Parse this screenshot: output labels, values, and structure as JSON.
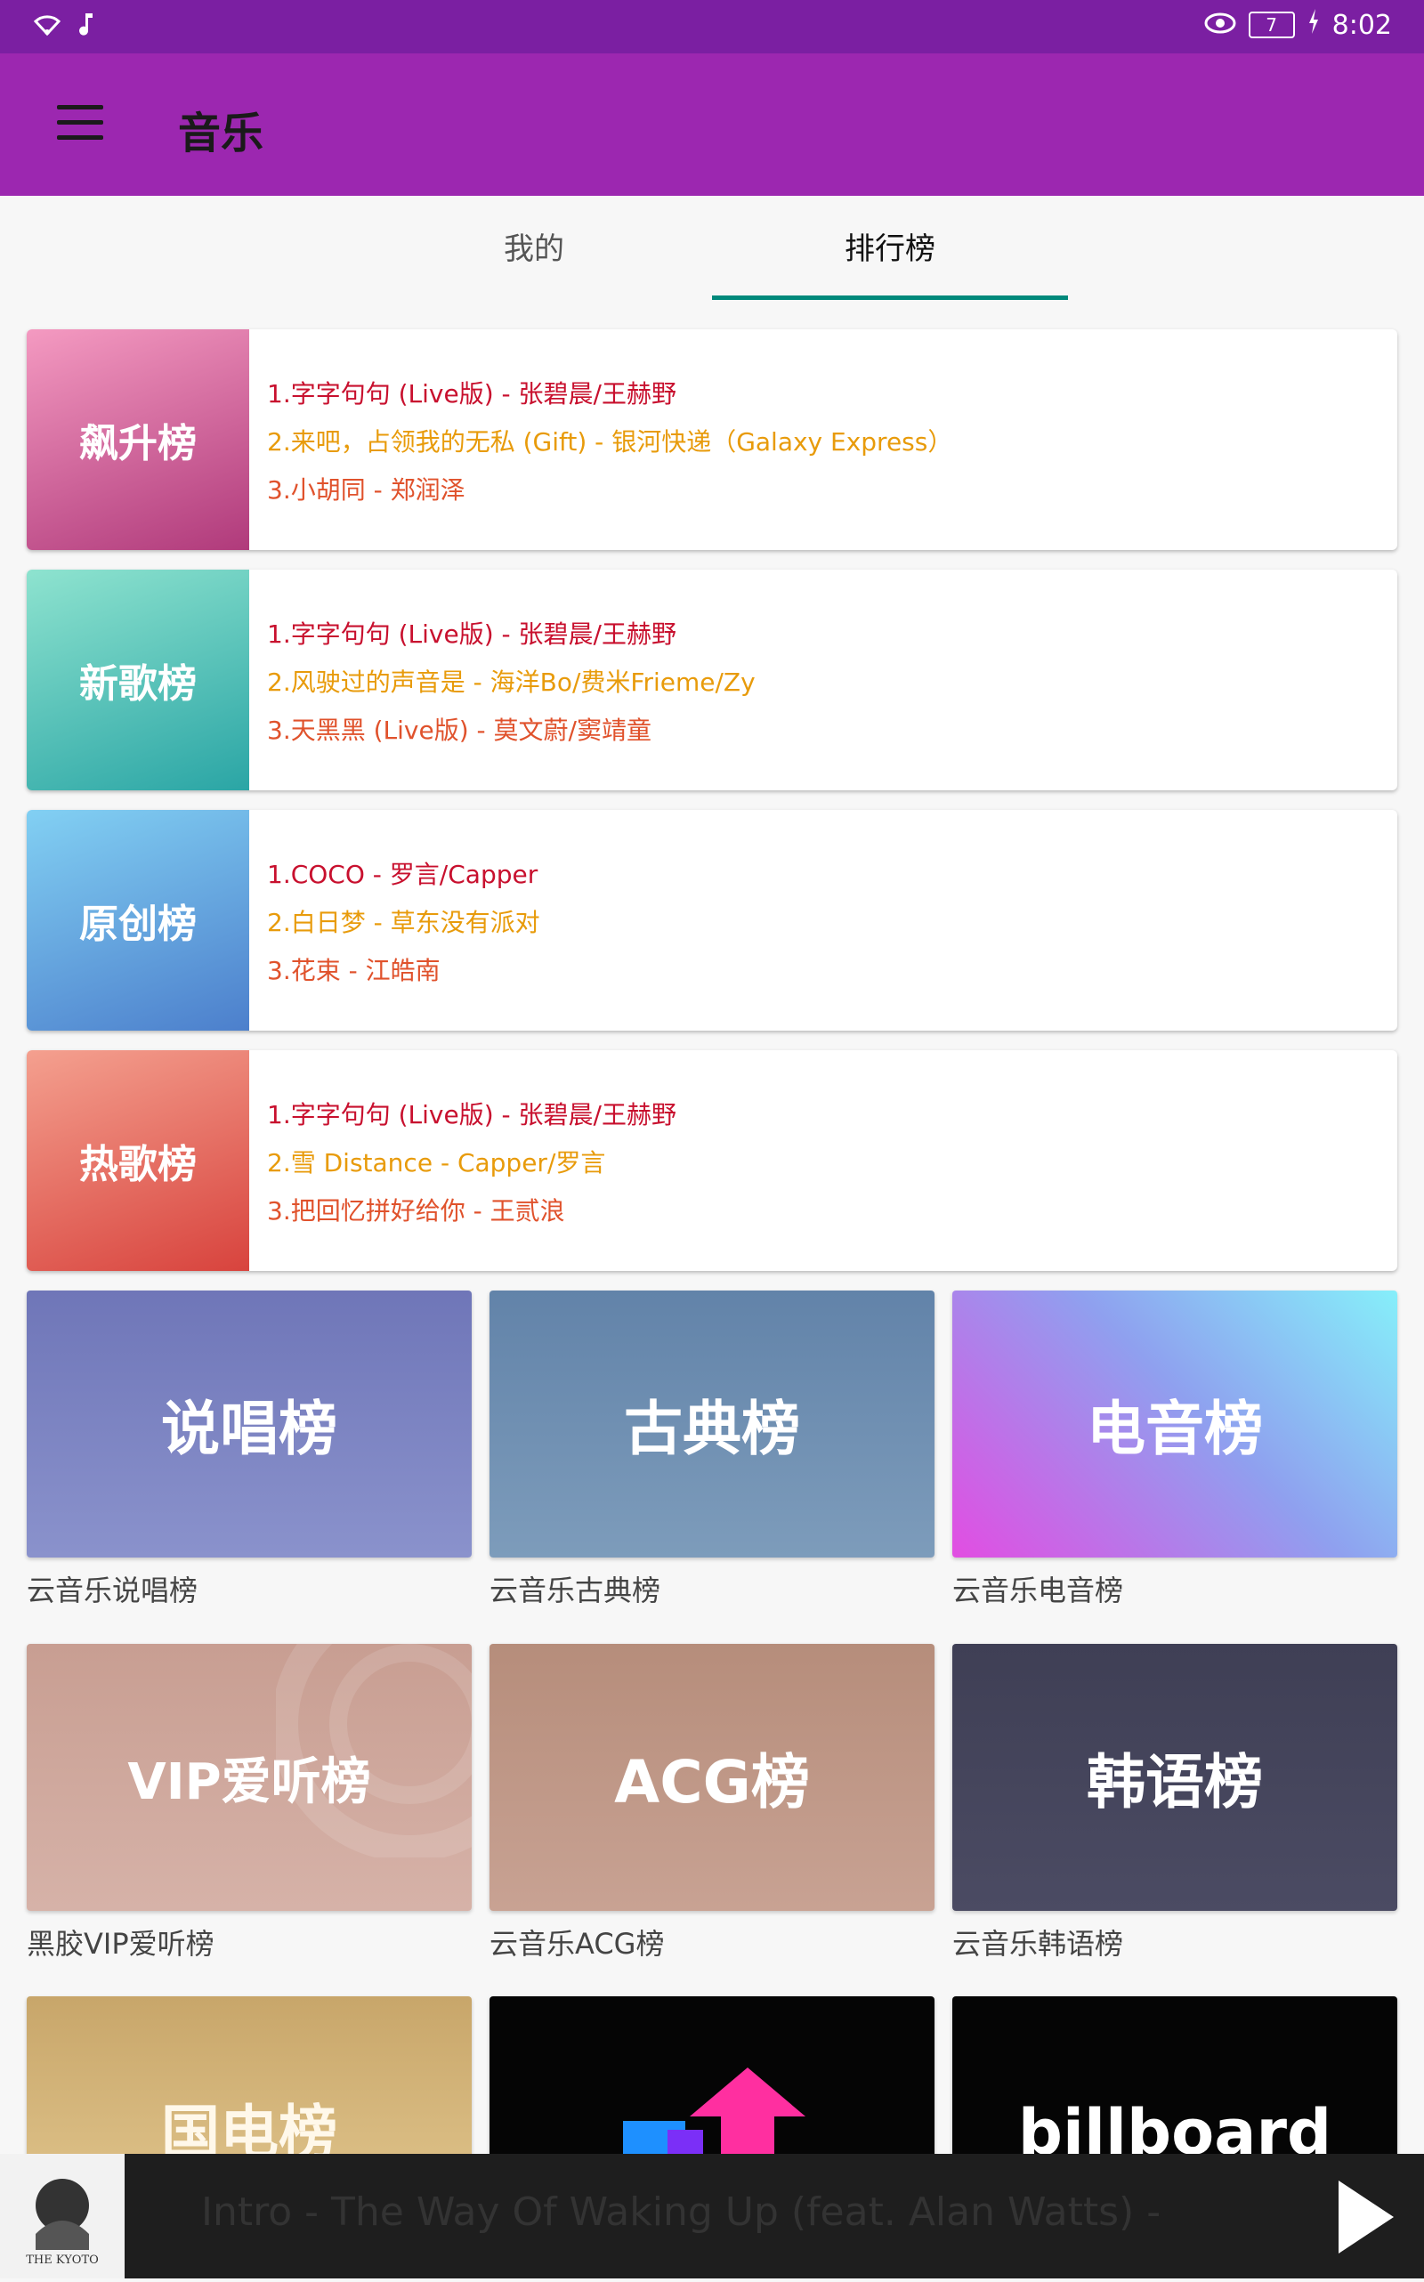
{
  "status": {
    "battery": "7",
    "time": "8:02"
  },
  "app": {
    "title": "音乐"
  },
  "tabs": [
    {
      "label": "我的",
      "active": false
    },
    {
      "label": "排行榜",
      "active": true
    }
  ],
  "charts": [
    {
      "name": "飙升榜",
      "songs": [
        "1.字字句句 (Live版) - 张碧晨/王赫野",
        "2.来吧，占领我的无私 (Gift) - 银河快递（Galaxy Express）",
        "3.小胡同 - 郑润泽"
      ]
    },
    {
      "name": "新歌榜",
      "songs": [
        "1.字字句句 (Live版) - 张碧晨/王赫野",
        "2.风驶过的声音是 - 海洋Bo/费米Frieme/Zy",
        "3.天黑黑 (Live版) - 莫文蔚/窦靖童"
      ]
    },
    {
      "name": "原创榜",
      "songs": [
        "1.COCO - 罗言/Capper",
        "2.白日梦 - 草东没有派对",
        "3.花束 - 江皓南"
      ]
    },
    {
      "name": "热歌榜",
      "songs": [
        "1.字字句句 (Live版) - 张碧晨/王赫野",
        "2.雪 Distance - Capper/罗言",
        "3.把回忆拼好给你 - 王贰浪"
      ]
    }
  ],
  "grid": [
    {
      "cover_text": "说唱榜",
      "label": "云音乐说唱榜"
    },
    {
      "cover_text": "古典榜",
      "label": "云音乐古典榜"
    },
    {
      "cover_text": "电音榜",
      "label": "云音乐电音榜"
    },
    {
      "cover_text": "VIP爱听榜",
      "label": "黑胶VIP爱听榜"
    },
    {
      "cover_text": "ACG榜",
      "label": "云音乐ACG榜"
    },
    {
      "cover_text": "韩语榜",
      "label": "云音乐韩语榜"
    },
    {
      "cover_text": "国电榜",
      "label": ""
    },
    {
      "cover_text": "",
      "label": ""
    },
    {
      "cover_text": "billboard",
      "label": ""
    }
  ],
  "player": {
    "track": "Intro - The Way Of Waking Up (feat. Alan Watts) -",
    "album_text": "THE KYOTO"
  }
}
